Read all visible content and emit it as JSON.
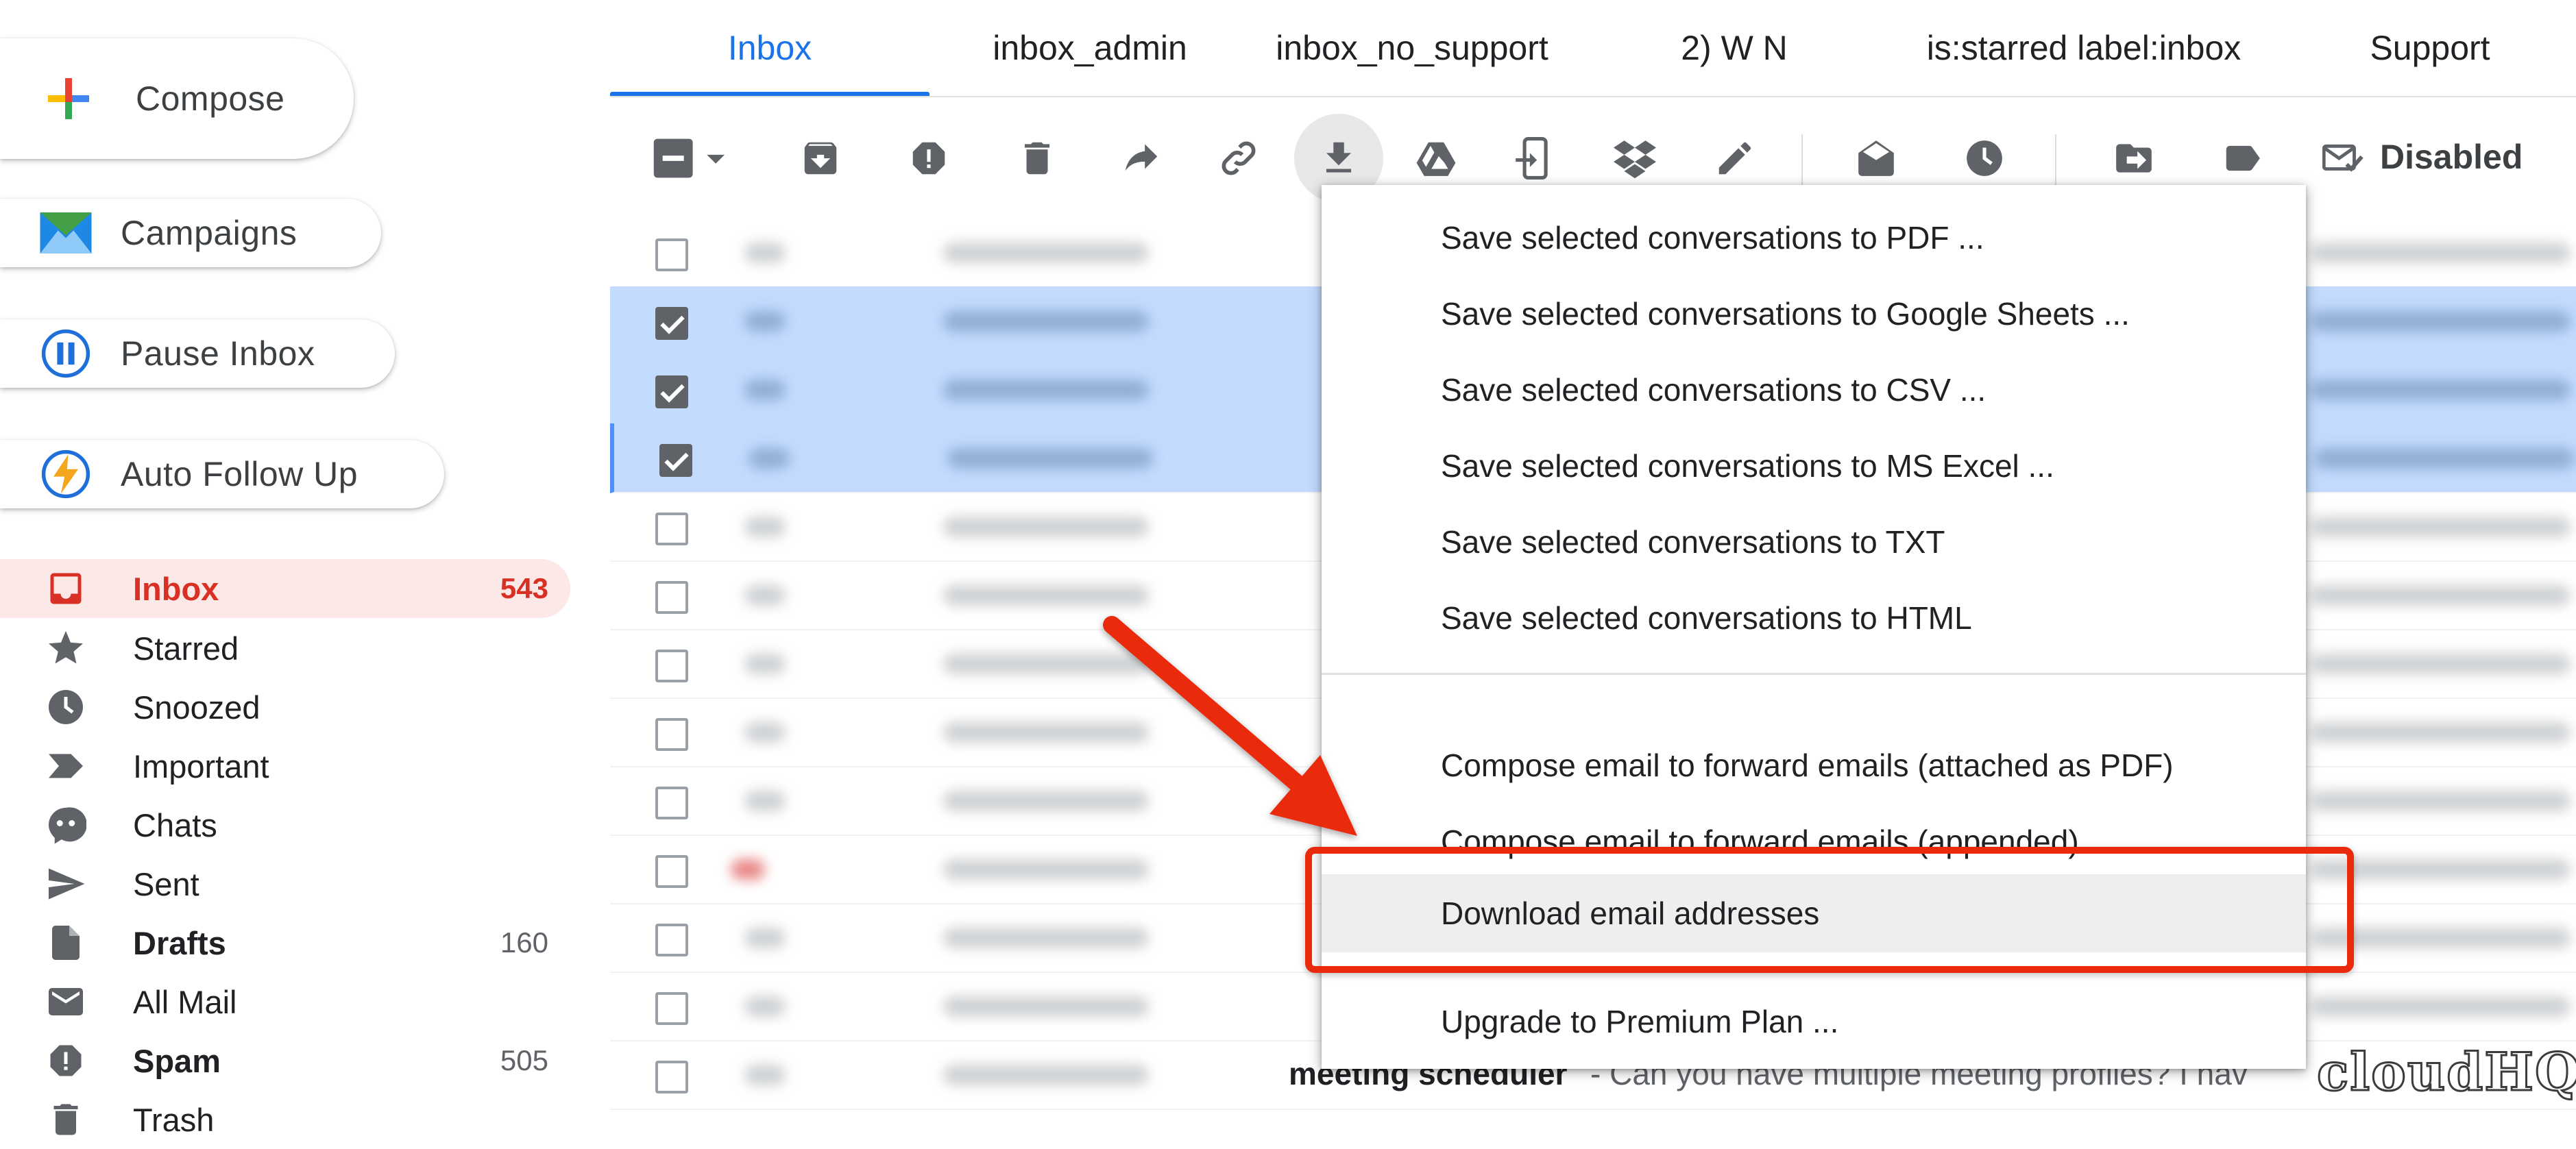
{
  "sidebar": {
    "compose_label": "Compose",
    "campaigns_label": "Campaigns",
    "pause_label": "Pause Inbox",
    "follow_label": "Auto Follow Up",
    "nav": [
      {
        "label": "Inbox",
        "count": "543",
        "icon": "inbox-icon"
      },
      {
        "label": "Starred",
        "count": "",
        "icon": "star-icon"
      },
      {
        "label": "Snoozed",
        "count": "",
        "icon": "clock-icon"
      },
      {
        "label": "Important",
        "count": "",
        "icon": "important-icon"
      },
      {
        "label": "Chats",
        "count": "",
        "icon": "chat-icon"
      },
      {
        "label": "Sent",
        "count": "",
        "icon": "send-icon"
      },
      {
        "label": "Drafts",
        "count": "160",
        "icon": "draft-icon"
      },
      {
        "label": "All Mail",
        "count": "",
        "icon": "mail-icon"
      },
      {
        "label": "Spam",
        "count": "505",
        "icon": "spam-icon"
      },
      {
        "label": "Trash",
        "count": "",
        "icon": "trash-icon"
      }
    ]
  },
  "tabs": [
    "Inbox",
    "inbox_admin",
    "inbox_no_support",
    "2) W N",
    "is:starred label:inbox",
    "Support"
  ],
  "toolbar": {
    "disabled_label": "Disabled"
  },
  "rows": {
    "visible_subject": "meeting scheduler",
    "visible_snippet": "- Can you have multiple meeting profiles? I hav"
  },
  "menu": {
    "items": [
      "Save selected conversations to PDF ...",
      "Save selected conversations to Google Sheets ...",
      "Save selected conversations to CSV ...",
      "Save selected conversations to MS Excel ...",
      "Save selected conversations to TXT",
      "Save selected conversations to HTML",
      "Compose email to forward emails (attached as PDF)",
      "Compose email to forward emails (appended)",
      "Download email addresses",
      "Upgrade to Premium Plan ..."
    ]
  },
  "watermark": "cloudHQ",
  "colors": {
    "accent_blue": "#1a73e8",
    "inbox_red": "#d93025",
    "highlight_red": "#ea2a0d",
    "selected_row": "#c2dbff"
  }
}
